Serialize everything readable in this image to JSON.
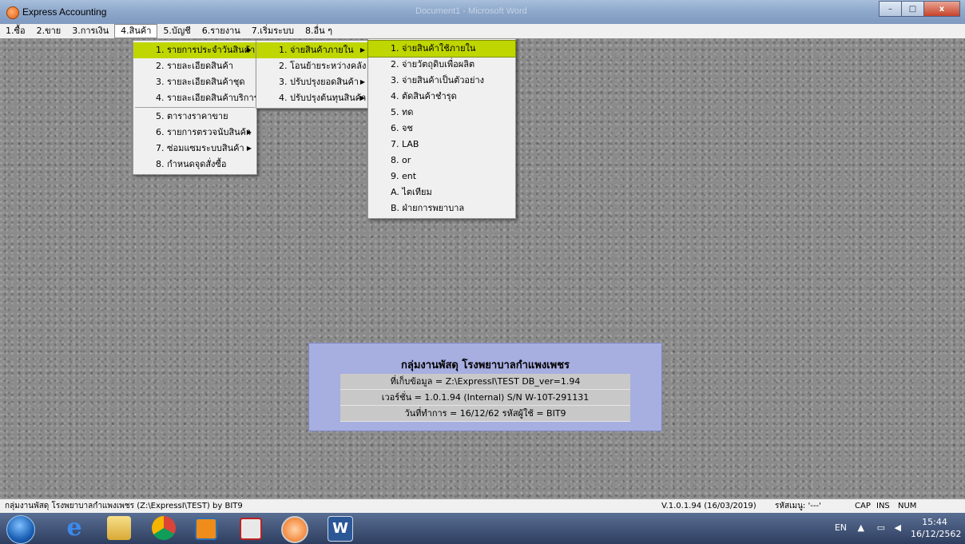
{
  "window": {
    "title": "Express Accounting",
    "background_title": "Document1 - Microsoft Word",
    "buttons": {
      "minimize": "–",
      "maximize": "□",
      "close": "x"
    }
  },
  "menubar": [
    "1.ซื้อ",
    "2.ขาย",
    "3.การเงิน",
    "4.สินค้า",
    "5.บัญชี",
    "6.รายงาน",
    "7.เริ่มระบบ",
    "8.อื่น ๆ"
  ],
  "menu_product": [
    "1. รายการประจำวันสินค้า",
    "2. รายละเอียดสินค้า",
    "3. รายละเอียดสินค้าชุด",
    "4. รายละเอียดสินค้าบริการ",
    "5. ตารางราคาขาย",
    "6. รายการตรวจนับสินค้า",
    "7. ซ่อมแซมระบบสินค้า",
    "8. กำหนดจุดสั่งซื้อ"
  ],
  "menu_daily": [
    "1. จ่ายสินค้าภายใน",
    "2. โอนย้ายระหว่างคลัง",
    "3. ปรับปรุงยอดสินค้า",
    "4. ปรับปรุงต้นทุนสินค้า"
  ],
  "menu_issue": [
    "1. จ่ายสินค้าใช้ภายใน",
    "2. จ่ายวัตถุดิบเพื่อผลิต",
    "3. จ่ายสินค้าเป็นตัวอย่าง",
    "4. ตัดสินค้าชำรุด",
    "5. ทด",
    "6. จช",
    "7. LAB",
    "8. or",
    "9. ent",
    "A. ไตเทียม",
    "B. ฝ่ายการพยาบาล"
  ],
  "info": {
    "heading": "กลุ่มงานพัสดุ โรงพยาบาลกำแพงเพชร",
    "location": "ที่เก็บข้อมูล = Z:\\ExpressI\\TEST    DB_ver=1.94",
    "version": "เวอร์ชั่น = 1.0.1.94 (Internal)    S/N W-10T-291131",
    "work_date": "วันที่ทำการ = 16/12/62    รหัสผู้ใช้ = BIT9"
  },
  "statusbar": {
    "left": "กลุ่มงานพัสดุ โรงพยาบาลกำแพงเพชร (Z:\\ExpressI\\TEST) by BIT9",
    "version": "V.1.0.1.94 (16/03/2019)",
    "user_code": "รหัสเมนู: '---'",
    "caps": "CAP",
    "ins": "INS",
    "num": "NUM"
  },
  "taskbar": {
    "lang": "EN",
    "time": "15:44",
    "date": "16/12/2562"
  }
}
